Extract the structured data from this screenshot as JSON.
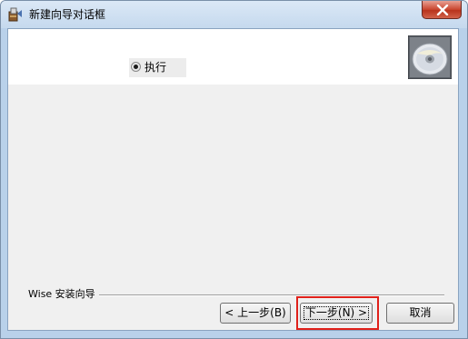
{
  "window": {
    "title": "新建向导对话框"
  },
  "titlebar": {
    "app_icon": "wizard-icon",
    "close_icon": "close-icon"
  },
  "header": {
    "logo_icon": "cd-disc-icon"
  },
  "main": {
    "radio_option": {
      "label": "执行",
      "checked": true
    }
  },
  "footer": {
    "group_label": "Wise 安装向导",
    "back_label": "< 上一步(B)",
    "next_label": "下一步(N) >",
    "cancel_label": "取消"
  },
  "colors": {
    "highlight": "#e0201a",
    "close_button": "#c9462f"
  }
}
